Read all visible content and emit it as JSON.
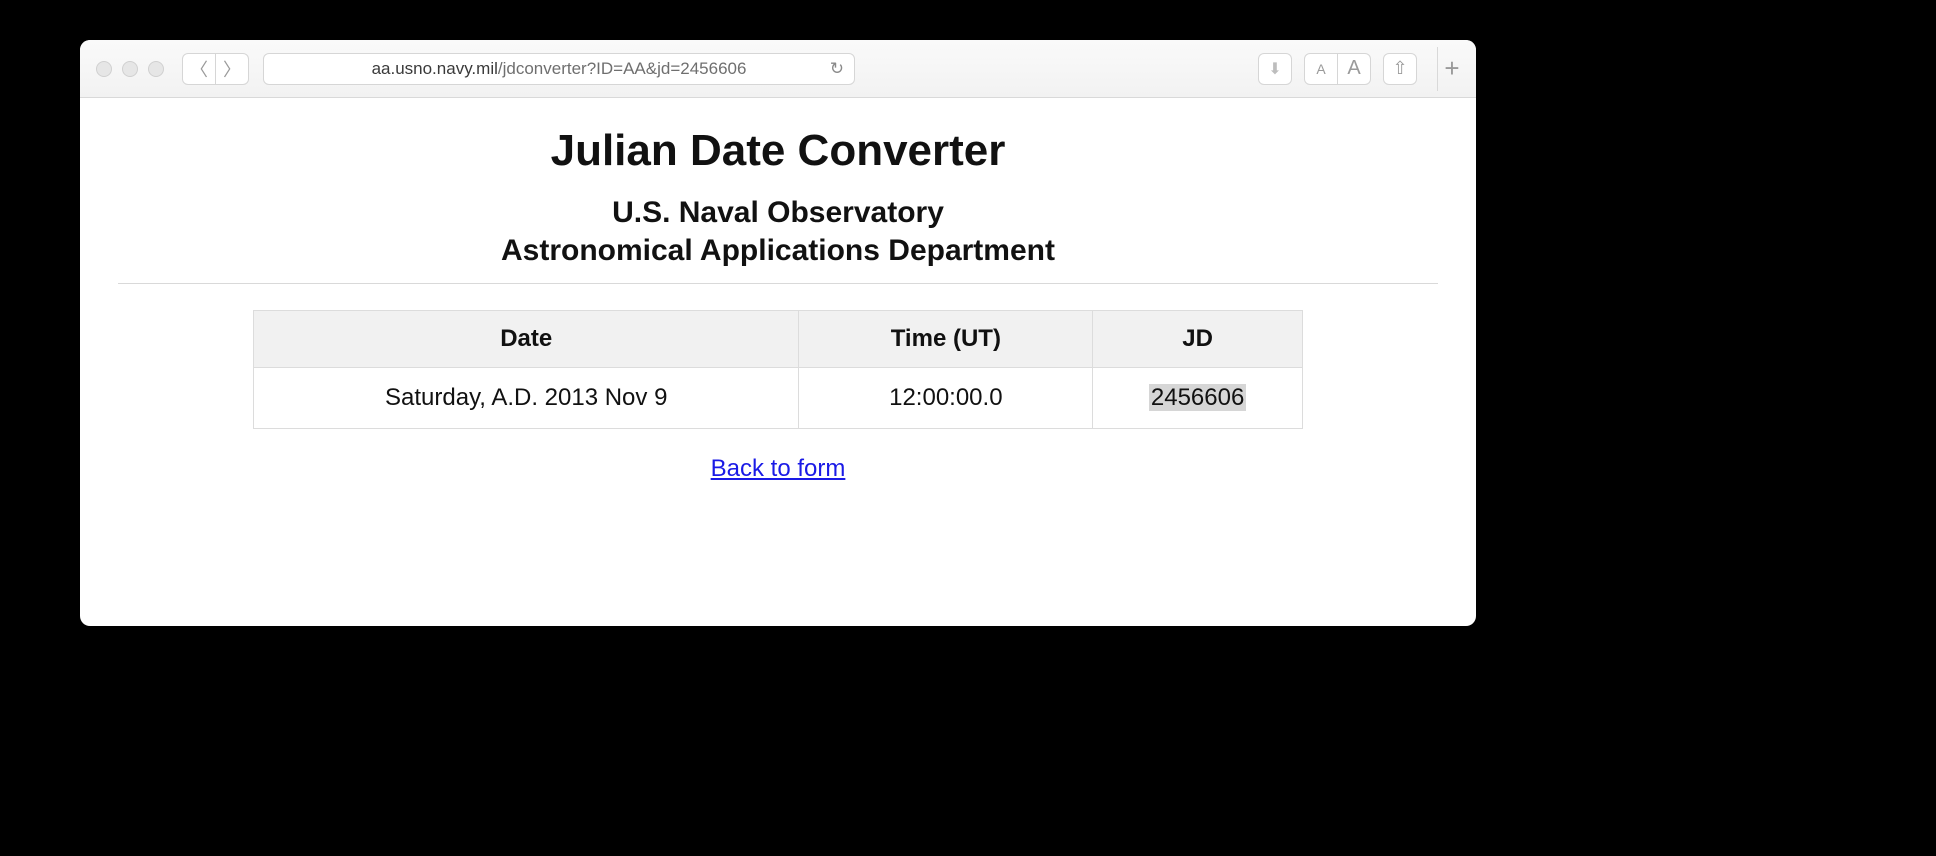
{
  "browser": {
    "url_host": "aa.usno.navy.mil",
    "url_path": "/jdconverter?ID=AA&jd=2456606",
    "nav_back_glyph": "〈",
    "nav_fwd_glyph": "〉",
    "refresh_glyph": "↻",
    "download_glyph": "⬇",
    "font_small": "A",
    "font_large": "A",
    "share_glyph": "⇧",
    "newtab_glyph": "+"
  },
  "page": {
    "title": "Julian Date Converter",
    "org_line1": "U.S. Naval Observatory",
    "org_line2": "Astronomical Applications Department",
    "table": {
      "headers": {
        "date": "Date",
        "time": "Time (UT)",
        "jd": "JD"
      },
      "row": {
        "date": "Saturday, A.D. 2013 Nov 9",
        "time": "12:00:00.0",
        "jd": "2456606"
      }
    },
    "back_link": "Back to form"
  }
}
